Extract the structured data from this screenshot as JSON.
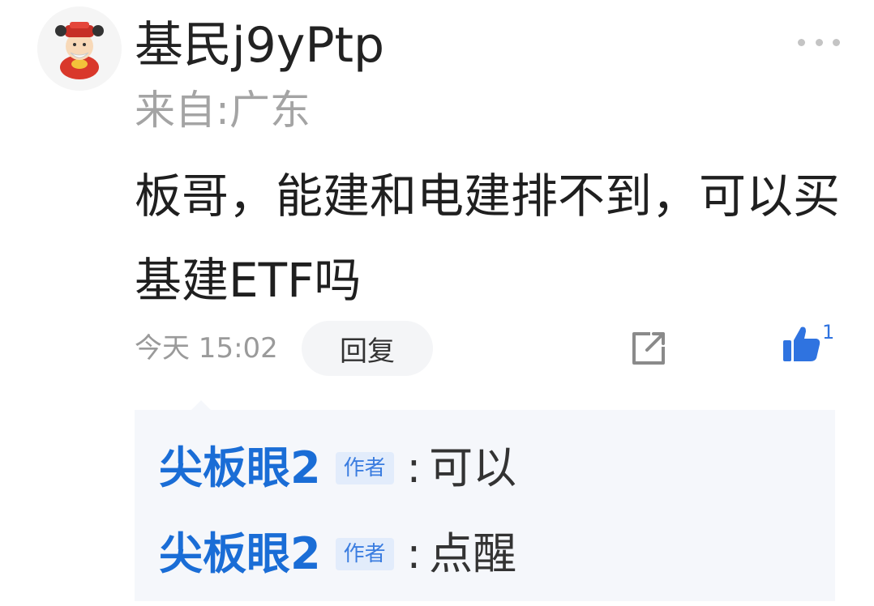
{
  "post": {
    "username": "基民j9yPtp",
    "location": "来自:广东",
    "content": "板哥，能建和电建排不到，可以买基建ETF吗",
    "time": "今天 15:02",
    "reply_label": "回复",
    "like_count": "1",
    "avatar_icon": "fortune-god-avatar",
    "accent_color": "#2f73e0"
  },
  "replies": [
    {
      "author": "尖板眼2",
      "badge": "作者",
      "colon": ":",
      "text": "可以"
    },
    {
      "author": "尖板眼2",
      "badge": "作者",
      "colon": ":",
      "text": "点醒"
    }
  ]
}
